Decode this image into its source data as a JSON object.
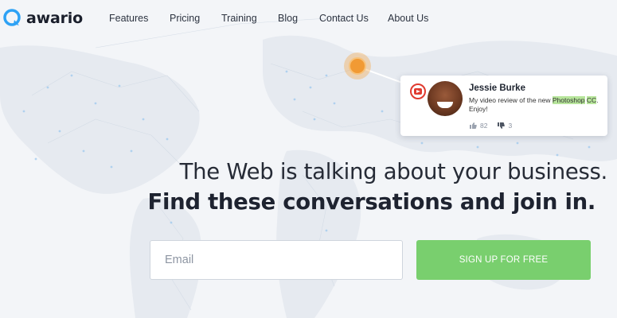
{
  "brand": {
    "name": "awario",
    "accent": "#2ea2f5"
  },
  "nav": {
    "items": [
      {
        "label": "Features"
      },
      {
        "label": "Pricing"
      },
      {
        "label": "Training"
      },
      {
        "label": "Blog"
      },
      {
        "label": "Contact Us"
      },
      {
        "label": "About Us"
      }
    ]
  },
  "mention_card": {
    "source_icon": "youtube-icon",
    "author": "Jessie Burke",
    "comment_before": "My video review of the new ",
    "comment_highlight_1": "Photoshop",
    "comment_space": " ",
    "comment_highlight_2": "CC",
    "comment_after": ". Enjoy!",
    "likes": "82",
    "dislikes": "3"
  },
  "hero": {
    "headline": "The Web is talking about your business.",
    "subheadline": "Find these conversations and join in."
  },
  "signup_form": {
    "email_placeholder": "Email",
    "email_value": "",
    "button_label": "SIGN UP FOR FREE",
    "button_color": "#79cf6e"
  }
}
